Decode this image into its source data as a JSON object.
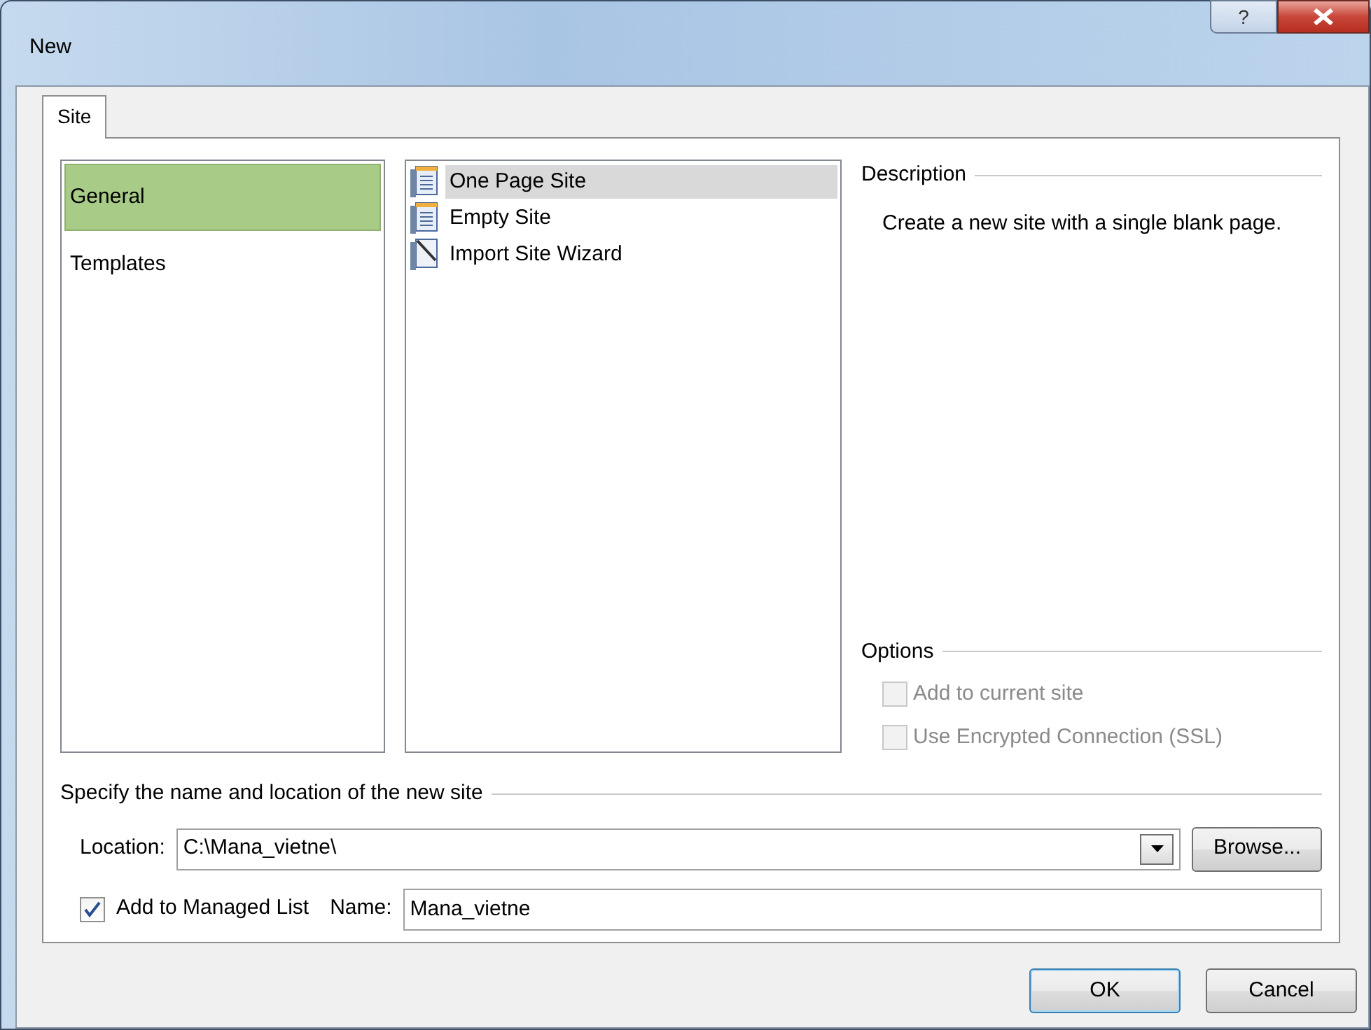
{
  "window": {
    "title": "New",
    "help_button": "?"
  },
  "tabs": [
    {
      "label": "Site",
      "selected": true
    }
  ],
  "categories": [
    {
      "label": "General",
      "selected": true
    },
    {
      "label": "Templates",
      "selected": false
    }
  ],
  "site_types": [
    {
      "label": "One Page Site",
      "kind": "page",
      "selected": true
    },
    {
      "label": "Empty Site",
      "kind": "page",
      "selected": false
    },
    {
      "label": "Import Site Wizard",
      "kind": "wizard",
      "selected": false
    }
  ],
  "description": {
    "heading": "Description",
    "text": "Create a new site with a single blank page."
  },
  "options": {
    "heading": "Options",
    "items": [
      {
        "label": "Add to current site",
        "checked": false,
        "disabled": true
      },
      {
        "label": "Use Encrypted Connection (SSL)",
        "checked": false,
        "disabled": true
      }
    ]
  },
  "location_section": {
    "heading": "Specify the name and location of the new site",
    "location_label": "Location:",
    "location_value": "C:\\Mana_vietne\\",
    "browse_button": "Browse...",
    "managed_list": {
      "label": "Add to Managed List",
      "checked": true
    },
    "name_label": "Name:",
    "name_value": "Mana_vietne"
  },
  "buttons": [
    {
      "label": "OK",
      "default": true
    },
    {
      "label": "Cancel",
      "default": false
    }
  ]
}
